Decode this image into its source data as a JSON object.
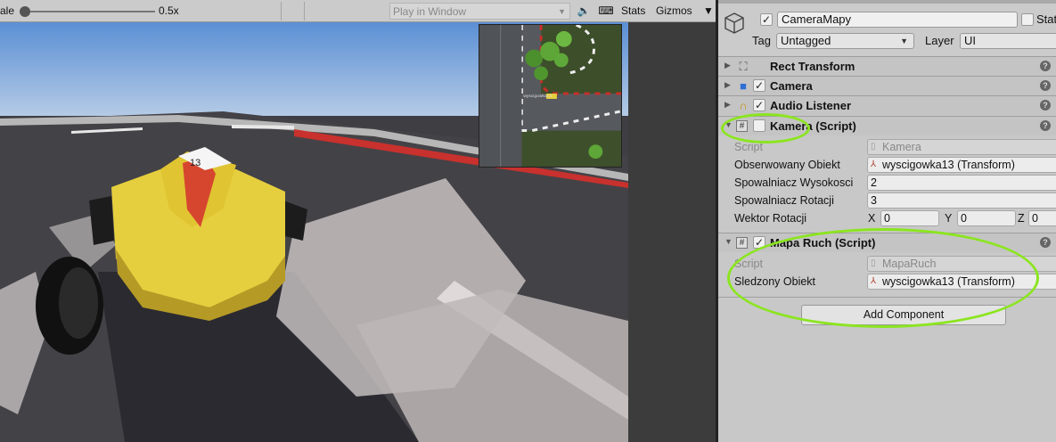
{
  "toolbar": {
    "scale_label": "ale",
    "scale_value": "0.5x",
    "play_mode": "Play in Window",
    "stats_label": "Stats",
    "gizmos_label": "Gizmos"
  },
  "minimap": {
    "car_label": "wyscigowka13"
  },
  "inspector": {
    "object_name": "CameraMapy",
    "active": true,
    "static_label": "Stat",
    "tag_label": "Tag",
    "tag_value": "Untagged",
    "layer_label": "Layer",
    "layer_value": "UI",
    "components": [
      {
        "title": "Rect Transform",
        "icon": "rect-transform-icon",
        "has_checkbox": false
      },
      {
        "title": "Camera",
        "icon": "camera-icon",
        "has_checkbox": true,
        "enabled": true
      },
      {
        "title": "Audio Listener",
        "icon": "headphones-icon",
        "has_checkbox": true,
        "enabled": true
      },
      {
        "title": "Kamera (Script)",
        "icon": "script-hash-icon",
        "has_checkbox": true,
        "enabled": false
      },
      {
        "title": "Mapa Ruch (Script)",
        "icon": "script-hash-icon",
        "has_checkbox": true,
        "enabled": true
      }
    ],
    "kamera": {
      "script_label": "Script",
      "script_value": "Kamera",
      "obs_label": "Obserwowany Obiekt",
      "obs_value": "wyscigowka13 (Transform)",
      "spow_wys_label": "Spowalniacz Wysokosci",
      "spow_wys_value": "2",
      "spow_rot_label": "Spowalniacz Rotacji",
      "spow_rot_value": "3",
      "wektor_label": "Wektor Rotacji",
      "x_label": "X",
      "x_value": "0",
      "y_label": "Y",
      "y_value": "0",
      "z_label": "Z",
      "z_value": "0"
    },
    "mapa": {
      "script_label": "Script",
      "script_value": "MapaRuch",
      "sledz_label": "Sledzony Obiekt",
      "sledz_value": "wyscigowka13 (Transform)"
    },
    "add_component_label": "Add Component"
  },
  "colors": {
    "highlight": "#8be51f",
    "inspector_bg": "#c8c8c8",
    "track_red": "#c8312d",
    "car_yellow": "#e6cf3e"
  }
}
